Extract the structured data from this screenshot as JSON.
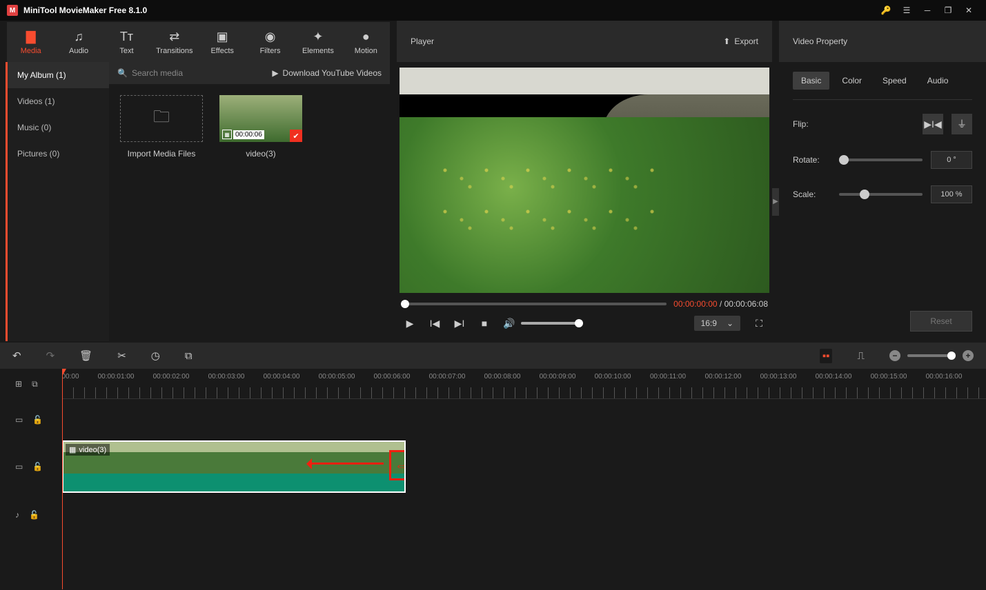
{
  "app": {
    "title": "MiniTool MovieMaker Free 8.1.0"
  },
  "tabs": {
    "media": {
      "label": "Media"
    },
    "audio": {
      "label": "Audio"
    },
    "text": {
      "label": "Text"
    },
    "transitions": {
      "label": "Transitions"
    },
    "effects": {
      "label": "Effects"
    },
    "filters": {
      "label": "Filters"
    },
    "elements": {
      "label": "Elements"
    },
    "motion": {
      "label": "Motion"
    }
  },
  "player": {
    "title": "Player",
    "export": "Export",
    "time_current": "00:00:00:00",
    "time_separator": " / ",
    "time_total": "00:00:06:08",
    "aspect": "16:9"
  },
  "library": {
    "sidebar": {
      "myalbum": "My Album (1)",
      "videos": "Videos (1)",
      "music": "Music (0)",
      "pictures": "Pictures (0)"
    },
    "search_placeholder": "Search media",
    "download_yt": "Download YouTube Videos",
    "import_label": "Import Media Files",
    "clip": {
      "duration": "00:00:06",
      "name": "video(3)"
    }
  },
  "property": {
    "title": "Video Property",
    "tabs": {
      "basic": "Basic",
      "color": "Color",
      "speed": "Speed",
      "audio": "Audio"
    },
    "flip_label": "Flip:",
    "rotate_label": "Rotate:",
    "rotate_value": "0 °",
    "scale_label": "Scale:",
    "scale_value": "100 %",
    "reset": "Reset"
  },
  "timeline": {
    "ruler": [
      "00:00",
      "00:00:01:00",
      "00:00:02:00",
      "00:00:03:00",
      "00:00:04:00",
      "00:00:05:00",
      "00:00:06:00",
      "00:00:07:00",
      "00:00:08:00",
      "00:00:09:00",
      "00:00:10:00",
      "00:00:11:00",
      "00:00:12:00",
      "00:00:13:00",
      "00:00:14:00",
      "00:00:15:00",
      "00:00:16:00"
    ],
    "clip_name": "video(3)"
  }
}
